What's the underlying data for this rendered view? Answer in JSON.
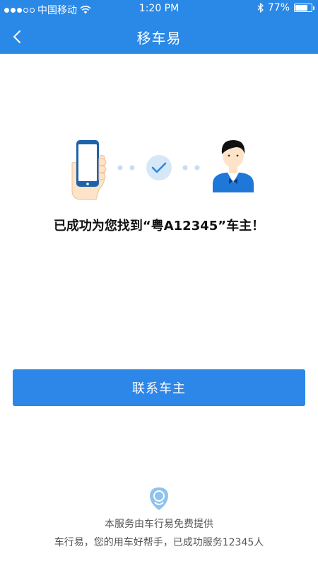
{
  "status_bar": {
    "carrier": "中国移动",
    "time": "1:20 PM",
    "battery": "77%",
    "battery_level": 0.77,
    "signal_bars_filled": 3,
    "signal_bars_total": 5
  },
  "header": {
    "title": "移车易",
    "background_color": "#2a88e6"
  },
  "main": {
    "success_message": "已成功为您找到“粤A12345”车主！",
    "contact_button_label": "联系车主",
    "button_color": "#2d87e8"
  },
  "footer": {
    "line1": "本服务由车行易免费提供",
    "line2": "车行易，您的用车好帮手，已成功服务12345人"
  },
  "icons": {
    "back": "chevron-left-icon",
    "phone_hand": "phone-in-hand-icon",
    "check": "check-circle-icon",
    "owner": "car-owner-avatar-icon",
    "logo": "chexingyi-logo-icon",
    "wifi": "wifi-icon",
    "bluetooth": "bluetooth-icon",
    "battery": "battery-icon"
  }
}
